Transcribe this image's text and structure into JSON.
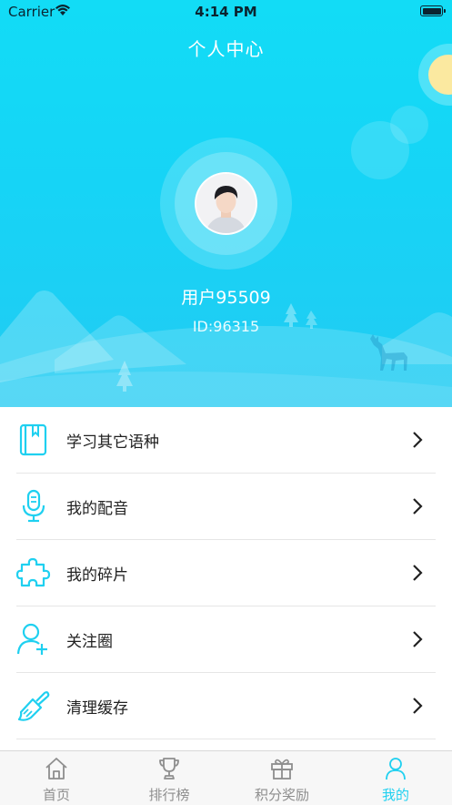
{
  "status_bar": {
    "carrier": "Carrier",
    "time": "4:14 PM"
  },
  "header": {
    "title": "个人中心"
  },
  "profile": {
    "username": "用户95509",
    "user_id": "ID:96315"
  },
  "menu": [
    {
      "label": "学习其它语种",
      "icon": "book-icon"
    },
    {
      "label": "我的配音",
      "icon": "microphone-icon"
    },
    {
      "label": "我的碎片",
      "icon": "puzzle-icon"
    },
    {
      "label": "关注圈",
      "icon": "add-user-icon"
    },
    {
      "label": "清理缓存",
      "icon": "brush-icon"
    }
  ],
  "tabbar": [
    {
      "label": "首页",
      "icon": "home-icon",
      "active": false
    },
    {
      "label": "排行榜",
      "icon": "trophy-icon",
      "active": false
    },
    {
      "label": "积分奖励",
      "icon": "gift-icon",
      "active": false
    },
    {
      "label": "我的",
      "icon": "person-icon",
      "active": true
    }
  ],
  "colors": {
    "accent": "#1fd0f0",
    "hero_top": "#12dcf6",
    "hero_bottom": "#22cbf2"
  }
}
